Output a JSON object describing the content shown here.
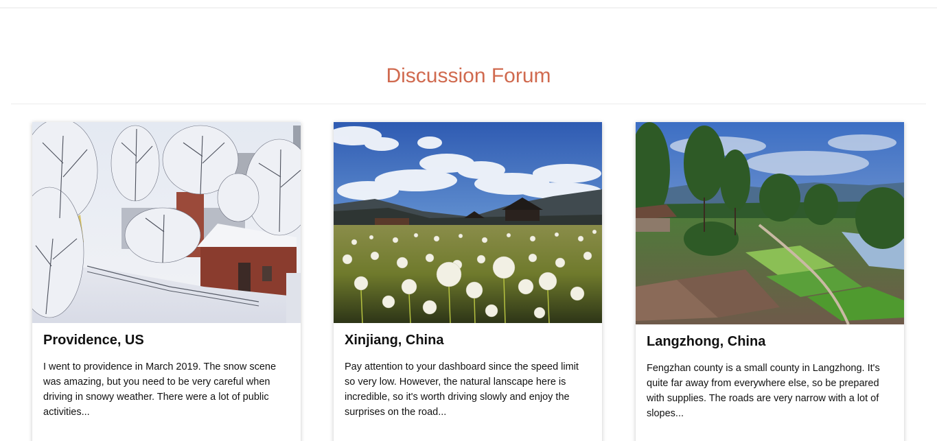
{
  "forum": {
    "title": "Discussion Forum"
  },
  "cards": [
    {
      "title": "Providence, US",
      "text": "I went to providence in March 2019. The snow scene was amazing, but you need to be very careful when driving in snowy weather. There were a lot of public activities..."
    },
    {
      "title": "Xinjiang, China",
      "text": "Pay attention to your dashboard since the speed limit so very low. However, the natural lanscape here is incredible, so it's worth driving slowly and enjoy the surprises on the road..."
    },
    {
      "title": "Langzhong, China",
      "text": "Fengzhan county is a small county in Langzhong. It's quite far away from everywhere else, so be prepared with supplies. The roads are very narrow with a lot of slopes..."
    }
  ]
}
